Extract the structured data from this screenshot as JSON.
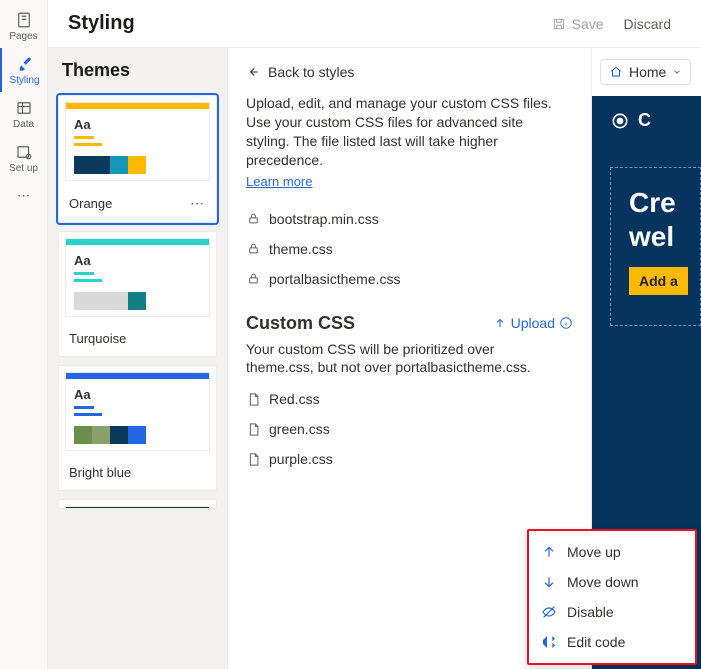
{
  "rail": {
    "items": [
      {
        "label": "Pages"
      },
      {
        "label": "Styling"
      },
      {
        "label": "Data"
      },
      {
        "label": "Set up"
      }
    ]
  },
  "header": {
    "title": "Styling",
    "save": "Save",
    "discard": "Discard"
  },
  "themes": {
    "title": "Themes",
    "items": [
      {
        "name": "Orange",
        "bar": "#ffb900",
        "accent": "#ffb900",
        "swatches": [
          "#0b3a5d",
          "#0b3a5d",
          "#1497b8",
          "#ffb900"
        ],
        "selected": true
      },
      {
        "name": "Turquoise",
        "bar": "#2ad2c9",
        "accent": "#2ad2c9",
        "swatches": [
          "#d9d9d9",
          "#d9d9d9",
          "#d9d9d9",
          "#147e87"
        ],
        "selected": false
      },
      {
        "name": "Bright blue",
        "bar": "#2266e3",
        "accent": "#2266e3",
        "swatches": [
          "#6b8e4e",
          "#8aa06b",
          "#0b3a5d",
          "#2266e3"
        ],
        "selected": false
      }
    ]
  },
  "styles": {
    "back": "Back to styles",
    "description": "Upload, edit, and manage your custom CSS files. Use your custom CSS files for advanced site styling. The file listed last will take higher precedence.",
    "learn_more": "Learn more",
    "base_files": [
      "bootstrap.min.css",
      "theme.css",
      "portalbasictheme.css"
    ],
    "custom_title": "Custom CSS",
    "upload": "Upload",
    "custom_note": "Your custom CSS will be prioritized over theme.css, but not over portalbasictheme.css.",
    "custom_files": [
      "Red.css",
      "green.css",
      "purple.css"
    ]
  },
  "preview": {
    "home": "Home",
    "brand": "C",
    "hero_line1": "Cre",
    "hero_line2": "wel",
    "cta": "Add a"
  },
  "context_menu": {
    "move_up": "Move up",
    "move_down": "Move down",
    "disable": "Disable",
    "edit_code": "Edit code"
  }
}
